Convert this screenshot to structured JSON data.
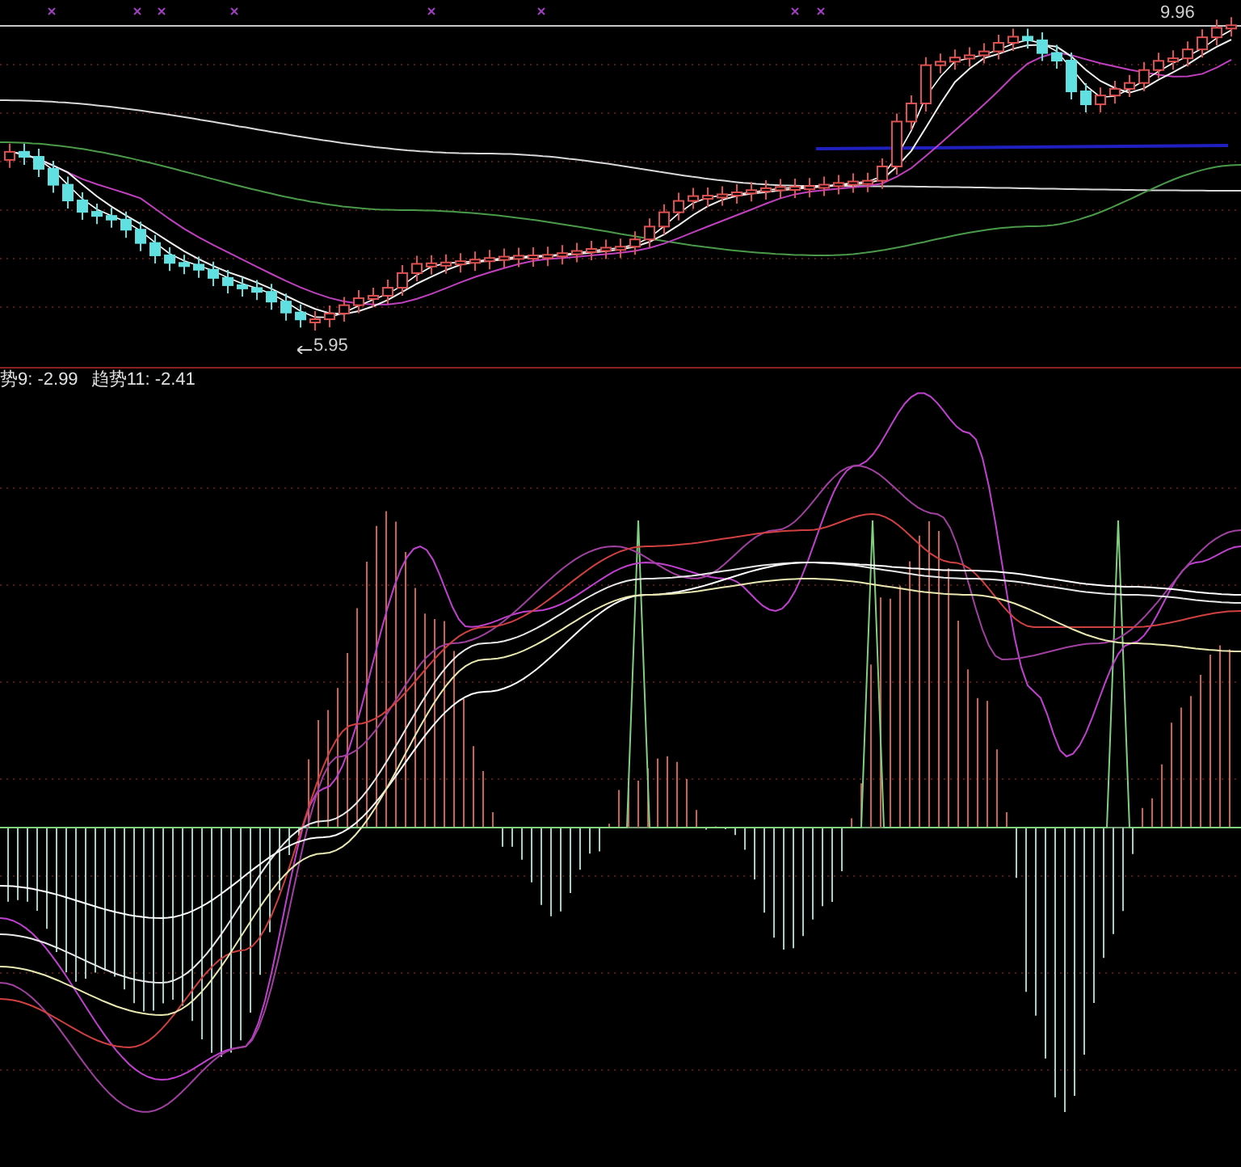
{
  "price_panel": {
    "high_label": "9.96",
    "low_label": "5.95"
  },
  "indicator_panel": {
    "legend": [
      {
        "label": "势9: -2.99"
      },
      {
        "label": "趋势11: -2.41"
      }
    ]
  }
}
